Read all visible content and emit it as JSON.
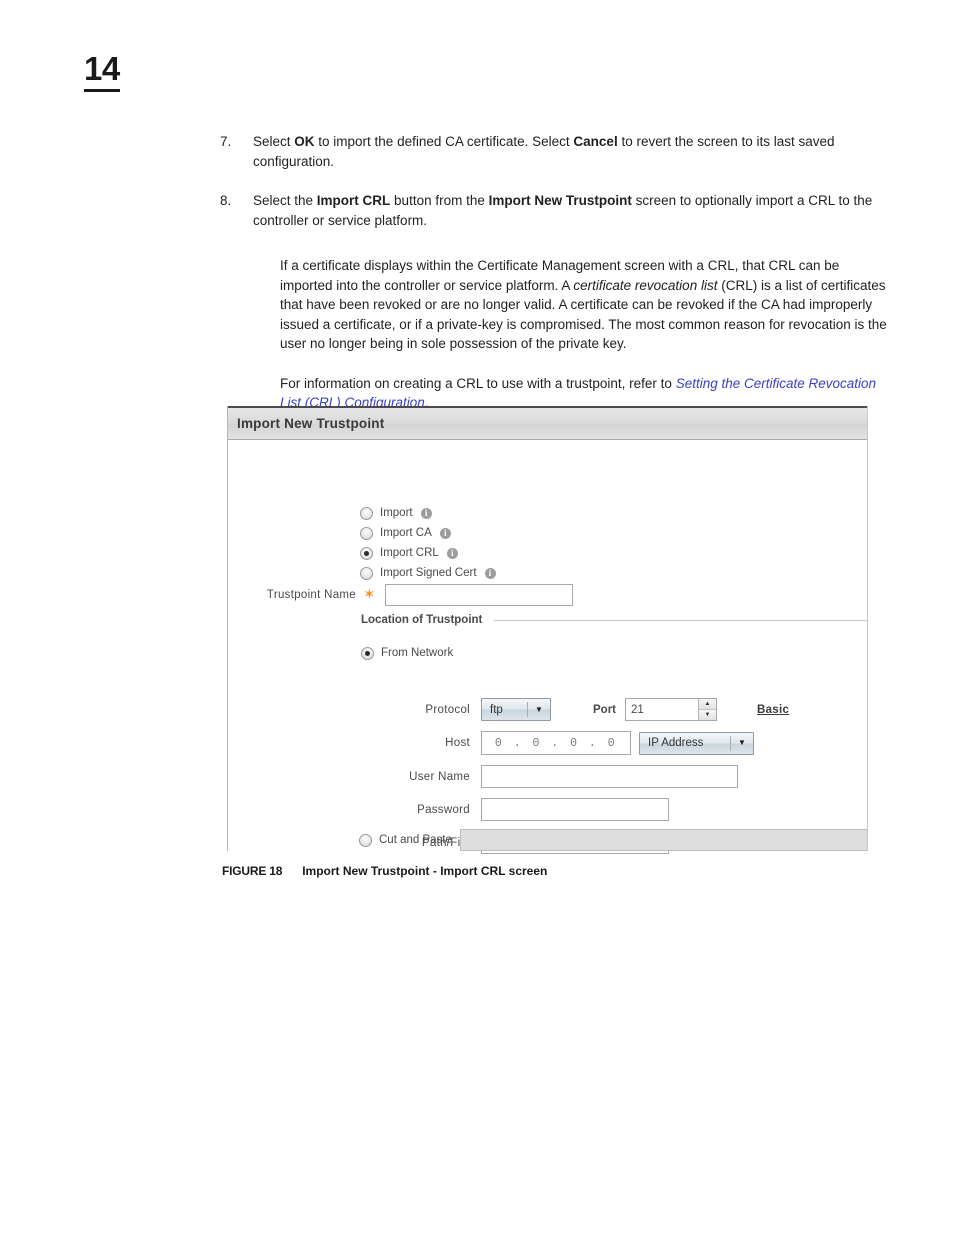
{
  "page": {
    "chapter_number": "14"
  },
  "steps": [
    {
      "number": "7.",
      "parts": [
        {
          "t": "Select ",
          "s": "n"
        },
        {
          "t": "OK",
          "s": "b"
        },
        {
          "t": " to import the defined CA certificate. Select ",
          "s": "n"
        },
        {
          "t": "Cancel",
          "s": "b"
        },
        {
          "t": " to revert the screen to its last saved configuration.",
          "s": "n"
        }
      ]
    },
    {
      "number": "8.",
      "parts": [
        {
          "t": "Select the ",
          "s": "n"
        },
        {
          "t": "Import CRL",
          "s": "b"
        },
        {
          "t": " button from the ",
          "s": "n"
        },
        {
          "t": "Import New Trustpoint",
          "s": "b"
        },
        {
          "t": " screen to optionally import a CRL to the controller or service platform.",
          "s": "n"
        }
      ]
    }
  ],
  "paragraphs": {
    "p1_a": "If a certificate displays within the Certificate Management screen with a CRL, that CRL can be imported into the controller or service platform. A ",
    "p1_italic": "certificate revocation list",
    "p1_b": " (CRL) is a list of certificates that have been revoked or are no longer valid. A certificate can be revoked if the CA had improperly issued a certificate, or if a private-key is compromised. The most common reason for revocation is the user no longer being in sole possession of the private key.",
    "p2_a": "For information on creating a CRL to use with a trustpoint, refer to ",
    "p2_link": "Setting the Certificate Revocation List (CRL) Configuration",
    "p2_b": "."
  },
  "dialog": {
    "title": "Import New Trustpoint",
    "import_options": [
      {
        "label": "Import",
        "selected": false
      },
      {
        "label": "Import CA",
        "selected": false
      },
      {
        "label": "Import CRL",
        "selected": true
      },
      {
        "label": "Import Signed Cert",
        "selected": false
      }
    ],
    "trustpoint_name": {
      "label": "Trustpoint Name",
      "required_marker": "✶",
      "value": ""
    },
    "location_section": {
      "label": "Location of Trustpoint",
      "from_network": {
        "label": "From Network",
        "selected": true
      },
      "cut_and_paste": {
        "label": "Cut and Paste",
        "selected": false,
        "value": ""
      }
    },
    "network_form": {
      "protocol": {
        "label": "Protocol",
        "value": "ftp"
      },
      "port": {
        "label": "Port",
        "value": "21"
      },
      "basic_link": "Basic",
      "host": {
        "label": "Host",
        "value": "0 . 0 . 0 . 0",
        "type": "IP Address"
      },
      "user_name": {
        "label": "User Name",
        "value": ""
      },
      "password": {
        "label": "Password",
        "value": ""
      },
      "path_file": {
        "label": "Path/File",
        "value": ""
      }
    },
    "arrow_glyph": "▼",
    "spinner_up": "▲",
    "spinner_down": "▼"
  },
  "figure": {
    "number": "FIGURE 18",
    "caption": "Import New Trustpoint - Import CRL screen"
  }
}
